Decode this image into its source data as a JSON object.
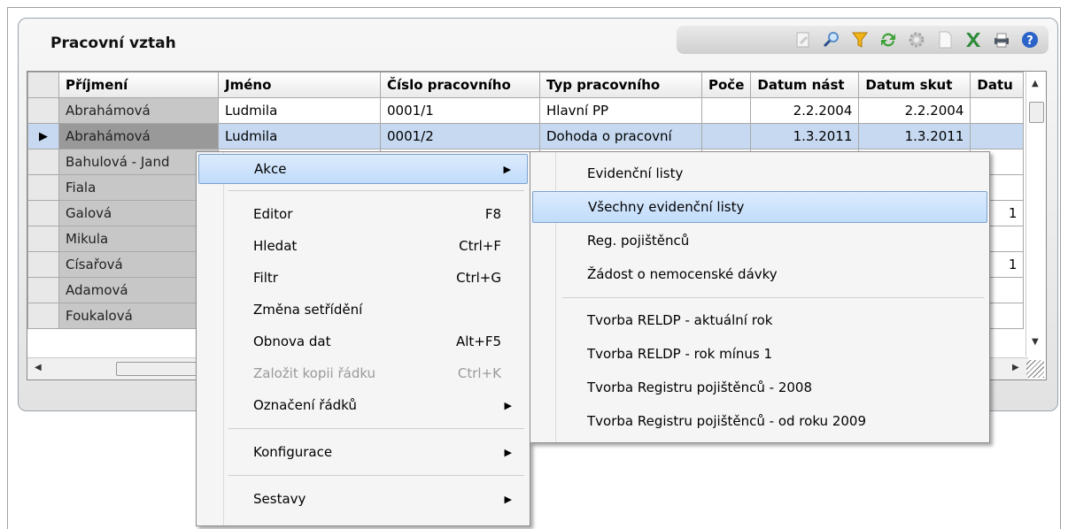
{
  "panel": {
    "title": "Pracovní vztah"
  },
  "toolbar": {
    "icons": [
      "edit-icon",
      "search-icon",
      "filter-icon",
      "refresh-icon",
      "settings-icon",
      "document-icon",
      "excel-icon",
      "print-icon",
      "help-icon"
    ],
    "colors": {
      "filter": "#f2b318",
      "refresh": "#3aa135",
      "excel": "#2e8b3a",
      "help": "#2b63c8"
    }
  },
  "grid": {
    "columns": [
      "Příjmení",
      "Jméno",
      "Číslo pracovního",
      "Typ pracovního",
      "Poče",
      "Datum nást",
      "Datum skut",
      "Datu"
    ],
    "rows": [
      {
        "surname": "Abrahámová",
        "name": "Ludmila",
        "number": "0001/1",
        "type": "Hlavní PP",
        "count": "",
        "start": "2.2.2004",
        "actual": "2.2.2004",
        "extra": ""
      },
      {
        "surname": "Abrahámová",
        "name": "Ludmila",
        "number": "0001/2",
        "type": "Dohoda o pracovní",
        "count": "",
        "start": "1.3.2011",
        "actual": "1.3.2011",
        "extra": ""
      },
      {
        "surname": "Bahulová - Jand"
      },
      {
        "surname": "Fiala"
      },
      {
        "surname": "Galová",
        "extra": "1"
      },
      {
        "surname": "Mikula"
      },
      {
        "surname": "Císařová",
        "extra": "1"
      },
      {
        "surname": "Adamová"
      },
      {
        "surname": "Foukalová"
      }
    ]
  },
  "context_menu": {
    "items": [
      {
        "label": "Akce",
        "shortcut": ""
      },
      {
        "label": "Editor",
        "shortcut": "F8"
      },
      {
        "label": "Hledat",
        "shortcut": "Ctrl+F"
      },
      {
        "label": "Filtr",
        "shortcut": "Ctrl+G"
      },
      {
        "label": "Změna setřídění",
        "shortcut": ""
      },
      {
        "label": "Obnova dat",
        "shortcut": "Alt+F5"
      },
      {
        "label": "Založit kopii řádku",
        "shortcut": "Ctrl+K"
      },
      {
        "label": "Označení řádků",
        "shortcut": ""
      },
      {
        "label": "Konfigurace",
        "shortcut": ""
      },
      {
        "label": "Sestavy",
        "shortcut": ""
      }
    ]
  },
  "submenu": {
    "items": [
      "Evidenční listy",
      "Všechny evidenční listy",
      "Reg. pojištěnců",
      "Žádost o nemocenské dávky",
      "Tvorba RELDP - aktuální rok",
      "Tvorba RELDP - rok mínus 1",
      "Tvorba Registru pojištěnců - 2008",
      "Tvorba Registru pojištěnců - od roku 2009"
    ]
  }
}
